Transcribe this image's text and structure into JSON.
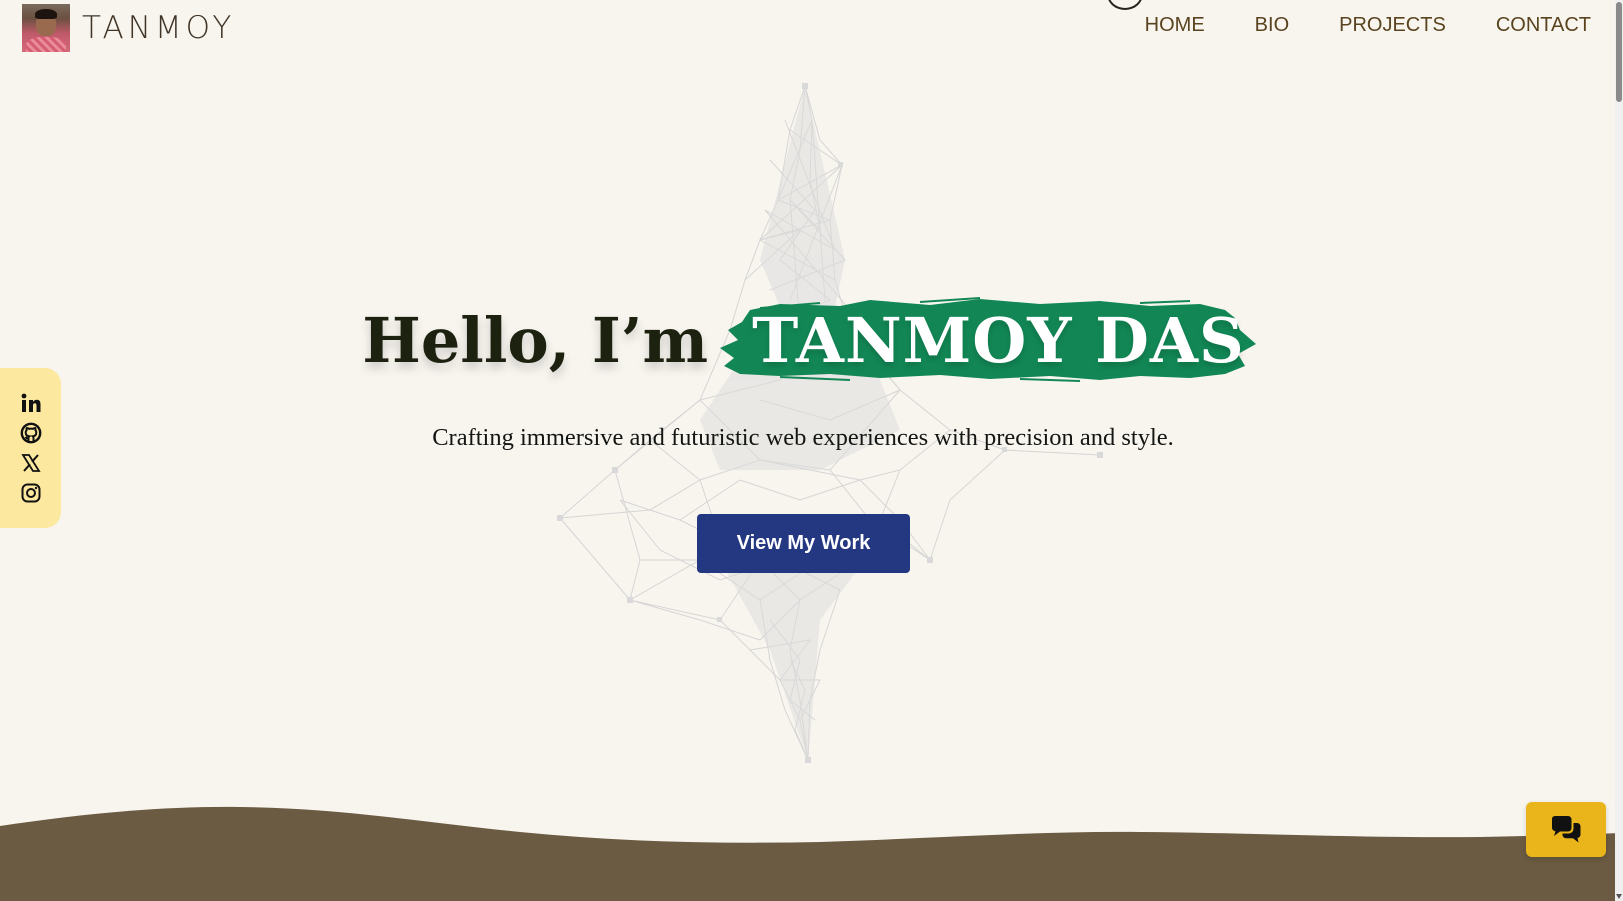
{
  "brand": {
    "name": "TANMOY",
    "avatar_icon": "profile-photo"
  },
  "nav": {
    "items": [
      {
        "label": "HOME"
      },
      {
        "label": "BIO"
      },
      {
        "label": "PROJECTS"
      },
      {
        "label": "CONTACT"
      }
    ]
  },
  "hero": {
    "greeting": "Hello, I’m",
    "name": "TANMOY DAS",
    "tagline": "Crafting immersive and futuristic web experiences with precision and style.",
    "cta_label": "View My Work"
  },
  "social": {
    "items": [
      {
        "icon": "linkedin-icon"
      },
      {
        "icon": "github-icon"
      },
      {
        "icon": "x-twitter-icon"
      },
      {
        "icon": "instagram-icon"
      }
    ]
  },
  "chat": {
    "icon": "chat-bubbles-icon"
  },
  "colors": {
    "background": "#f8f5ef",
    "nav_text": "#5a431f",
    "brush_green": "#128755",
    "cta_blue": "#243882",
    "social_bg": "#fde8a0",
    "wave_brown": "#6b5b42",
    "chat_yellow": "#e9b51a"
  }
}
